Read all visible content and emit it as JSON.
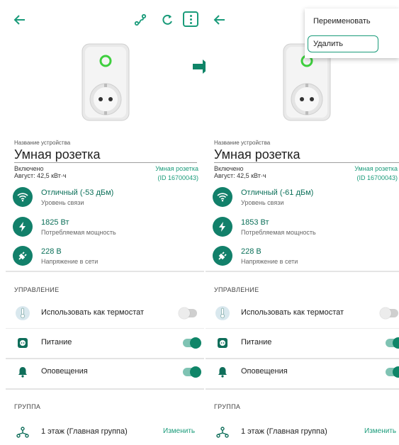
{
  "left": {
    "device_label": "Название устройства",
    "device_name": "Умная розетка",
    "status": "Включено",
    "energy": "Август: 42,5 кВт·ч",
    "device_type": "Умная розетка",
    "device_id": "(ID 16700043)",
    "signal": {
      "title": "Отличный (-53 дБм)",
      "subtitle": "Уровень связи"
    },
    "power": {
      "title": "1825 Вт",
      "subtitle": "Потребляемая мощность"
    },
    "voltage": {
      "title": "228 В",
      "subtitle": "Напряжение в сети"
    },
    "control_header": "УПРАВЛЕНИЕ",
    "thermostat": "Использовать как термостат",
    "power_switch": "Питание",
    "notifications": "Оповещения",
    "group_header": "ГРУППА",
    "group_name": "1 этаж (Главная группа)",
    "change": "Изменить"
  },
  "right": {
    "device_label": "Название устройства",
    "device_name": "Умная розетка",
    "status": "Включено",
    "energy": "Август: 42,5 кВт·ч",
    "device_type": "Умная розетка",
    "device_id": "(ID 16700043)",
    "signal": {
      "title": "Отличный (-61 дБм)",
      "subtitle": "Уровень связи"
    },
    "power": {
      "title": "1853 Вт",
      "subtitle": "Потребляемая мощность"
    },
    "voltage": {
      "title": "228 В",
      "subtitle": "Напряжение в сети"
    },
    "control_header": "УПРАВЛЕНИЕ",
    "thermostat": "Использовать как термостат",
    "power_switch": "Питание",
    "notifications": "Оповещения",
    "group_header": "ГРУППА",
    "group_name": "1 этаж (Главная группа)",
    "change": "Изменить"
  },
  "menu": {
    "rename": "Переименовать",
    "delete": "Удалить"
  },
  "toggles": {
    "thermostat": false,
    "power_switch": true,
    "notifications": true
  },
  "icons": [
    "back-arrow-icon",
    "route-icon",
    "refresh-icon",
    "more-menu-icon",
    "wifi-icon",
    "lightning-icon",
    "plug-icon",
    "thermometer-icon",
    "power-socket-icon",
    "bell-icon",
    "network-group-icon"
  ],
  "colors": {
    "accent": "#1a9b7a",
    "icon_bg": "#12806a",
    "toggle_on": "#0f8568"
  }
}
